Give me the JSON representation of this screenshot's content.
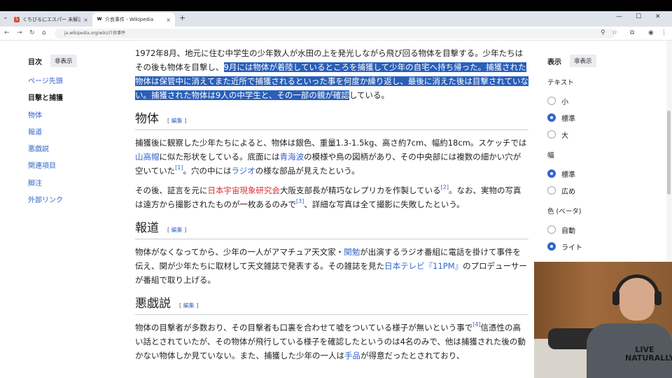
{
  "browser": {
    "tabs": [
      {
        "title": "くちびるにエスパー 未解決事件ファイル",
        "active": false
      },
      {
        "title": "介良事件 - Wikipedia",
        "active": true
      }
    ],
    "url": "ja.wikipedia.org/wiki/介良事件"
  },
  "toc": {
    "title": "目次",
    "hide_label": "非表示",
    "items": [
      "ページ先頭",
      "目撃と捕獲",
      "物体",
      "報道",
      "悪戯説",
      "関連項目",
      "脚注",
      "外部リンク"
    ]
  },
  "article": {
    "p1_plain": "1972年8月、地元に住む中学生の少年数人が水田の上を発光しながら飛び回る物体を目撃する。少年たちはその後も物体を目撃し、",
    "p1_selected": "9月には物体が着陸しているところを捕獲して少年の自宅へ持ち帰った。捕獲された物体は保管中に消えてまた近所で捕獲されるといった事を何度か繰り返し、最後に消えた後は目撃されていない。捕獲された物体は9人の中学生と、その一部の親が確認",
    "p1_tail": "している。",
    "edit_label": "編集",
    "sec_object": {
      "title": "物体",
      "p1_a": "捕獲後に観察した少年たちによると、物体は銀色、重量1.3-1.5kg、高さ約7cm、幅約18cm。スケッチでは",
      "link_yamataka": "山高帽",
      "p1_b": "に似た形状をしている。底面には",
      "link_aomi": "青海波",
      "p1_c": "の模様や鳥の図柄があり、その中央部には複数の細かい穴が空いていた",
      "ref1": "[1]",
      "p1_d": "。穴の中には",
      "link_radio": "ラジオ",
      "p1_e": "の様な部品が見えたという。",
      "p2_a": "その後、証言を元に",
      "link_jsps": "日本宇宙現象研究会",
      "p2_b": "大阪支部長が精巧なレプリカを作製している",
      "ref2": "[2]",
      "p2_c": "。なお、実物の写真は遠方から撮影されたものが一枚あるのみで",
      "ref3": "[3]",
      "p2_d": "、詳細な写真は全て撮影に失敗したという。"
    },
    "sec_report": {
      "title": "報道",
      "p_a": "物体がなくなってから、少年の一人がアマチュア天文家・",
      "link_seki": "関勉",
      "p_b": "が出演するラジオ番組に電話を掛けて事件を伝え、関が少年たちに取材して天文雑誌で発表する。その雑誌を見た",
      "link_ntv": "日本テレビ",
      "link_11pm": "『11PM』",
      "p_c": "のプロデューサーが番組で取り上げる。"
    },
    "sec_hoax": {
      "title": "悪戯説",
      "p_a": "物体の目撃者が多数おり、その目撃者も口裏を合わせて嘘をついている様子が無いという事で",
      "ref4": "[4]",
      "p_b": "信憑性の高い話とされていたが、その物体が飛行している様子を確認したというのは4名のみで、他は捕獲された後の動かない物体しか見ていない。また、捕獲した少年の一人は",
      "link_tejina": "手品",
      "p_c": "が得意だったとされており、"
    }
  },
  "appearance": {
    "title": "表示",
    "hide_label": "非表示",
    "text_label": "テキスト",
    "text_options": [
      "小",
      "標準",
      "大"
    ],
    "text_selected": 1,
    "width_label": "幅",
    "width_options": [
      "標準",
      "広め"
    ],
    "width_selected": 0,
    "color_label": "色 (ベータ)",
    "color_options": [
      "自動",
      "ライト"
    ],
    "color_selected": 1
  },
  "webcam": {
    "shirt_print": "LIVE NATURALLY"
  }
}
